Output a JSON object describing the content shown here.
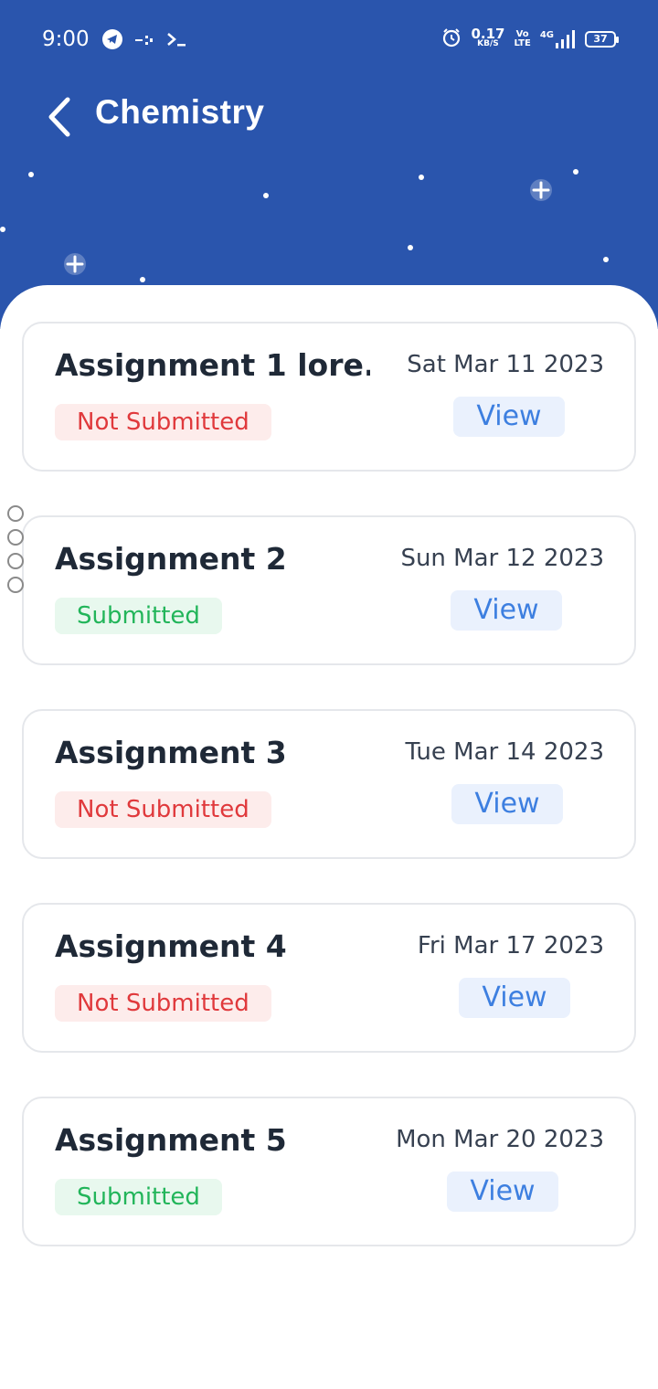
{
  "status_bar": {
    "time": "9:00",
    "speed_value": "0.17",
    "speed_unit": "KB/S",
    "volte_top": "Vo",
    "volte_bottom": "LTE",
    "network": "4G",
    "battery": "37",
    "icons": [
      "telegram-icon",
      "cast-icon",
      "terminal-icon",
      "alarm-icon",
      "signal-icon",
      "battery-icon"
    ]
  },
  "header": {
    "title": "Chemistry",
    "back_icon": "chevron-left-icon",
    "background_color": "#2a55ad"
  },
  "assignments": [
    {
      "title": "Assignment 1 lore...",
      "date": "Sat Mar 11 2023",
      "status": "Not Submitted",
      "status_type": "not_submitted",
      "action": "View"
    },
    {
      "title": "Assignment 2",
      "date": "Sun Mar 12 2023",
      "status": "Submitted",
      "status_type": "submitted",
      "action": "View"
    },
    {
      "title": "Assignment 3",
      "date": "Tue Mar 14 2023",
      "status": "Not Submitted",
      "status_type": "not_submitted",
      "action": "View"
    },
    {
      "title": "Assignment 4",
      "date": "Fri Mar 17 2023",
      "status": "Not Submitted",
      "status_type": "not_submitted",
      "action": "View"
    },
    {
      "title": "Assignment 5",
      "date": "Mon Mar 20 2023",
      "status": "Submitted",
      "status_type": "submitted",
      "action": "View"
    }
  ],
  "colors": {
    "not_submitted_text": "#e0393c",
    "not_submitted_bg": "#fdeceb",
    "submitted_text": "#22b55a",
    "submitted_bg": "#e8f8ee",
    "view_text": "#3d7fe0",
    "view_bg": "#eaf1fd"
  }
}
